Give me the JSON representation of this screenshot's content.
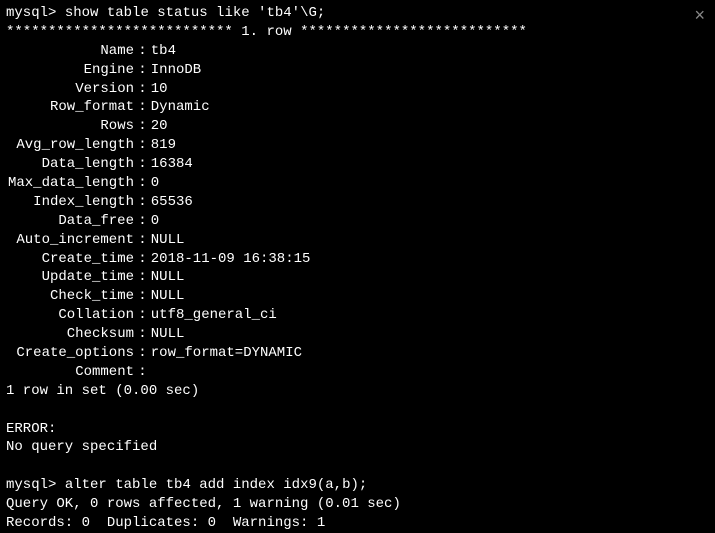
{
  "close_glyph": "×",
  "prompt": "mysql>",
  "cmd1": "show table status like 'tb4'\\G;",
  "row_banner_left": "***************************",
  "row_banner_mid": " 1. row ",
  "row_banner_right": "***************************",
  "fields": [
    {
      "k": "Name",
      "v": "tb4"
    },
    {
      "k": "Engine",
      "v": "InnoDB"
    },
    {
      "k": "Version",
      "v": "10"
    },
    {
      "k": "Row_format",
      "v": "Dynamic"
    },
    {
      "k": "Rows",
      "v": "20"
    },
    {
      "k": "Avg_row_length",
      "v": "819"
    },
    {
      "k": "Data_length",
      "v": "16384"
    },
    {
      "k": "Max_data_length",
      "v": "0"
    },
    {
      "k": "Index_length",
      "v": "65536"
    },
    {
      "k": "Data_free",
      "v": "0"
    },
    {
      "k": "Auto_increment",
      "v": "NULL"
    },
    {
      "k": "Create_time",
      "v": "2018-11-09 16:38:15"
    },
    {
      "k": "Update_time",
      "v": "NULL"
    },
    {
      "k": "Check_time",
      "v": "NULL"
    },
    {
      "k": "Collation",
      "v": "utf8_general_ci"
    },
    {
      "k": "Checksum",
      "v": "NULL"
    },
    {
      "k": "Create_options",
      "v": "row_format=DYNAMIC"
    },
    {
      "k": "Comment",
      "v": ""
    }
  ],
  "summary1": "1 row in set (0.00 sec)",
  "error_label": "ERROR:",
  "error_msg": "No query specified",
  "cmd2": "alter table tb4 add index idx9(a,b);",
  "result2a": "Query OK, 0 rows affected, 1 warning (0.01 sec)",
  "result2b": "Records: 0  Duplicates: 0  Warnings: 1"
}
